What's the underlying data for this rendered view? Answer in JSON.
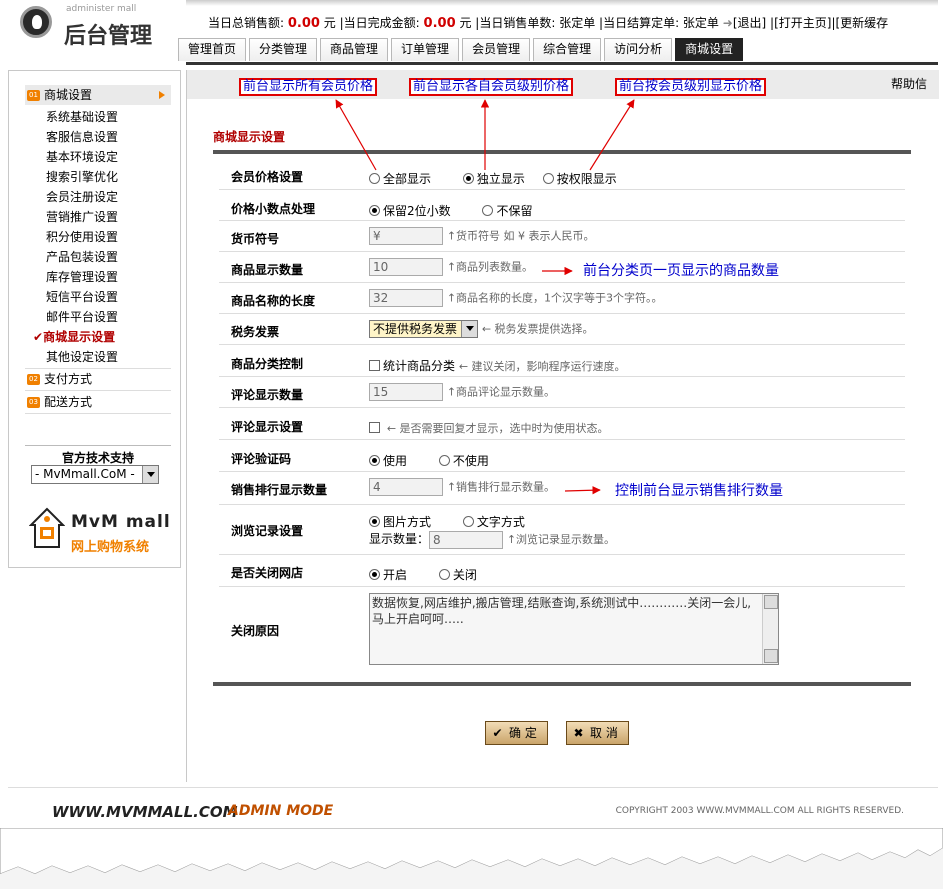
{
  "header": {
    "logo_small": "administer mall",
    "logo_title": "后台管理",
    "stats": {
      "total_sales_label": "当日总销售额:",
      "total_sales_value": "0.00",
      "total_sales_unit": "元",
      "completed_label": "|当日完成金额:",
      "completed_value": "0.00",
      "completed_unit": "元",
      "orders_label": "|当日销售单数: 张定单",
      "settled_label": "|当日结算定单: 张定单",
      "logout": "[退出]",
      "open_home": "|[打开主页]|",
      "update_cache": "[更新缓存"
    },
    "tabs": [
      {
        "label": "管理首页"
      },
      {
        "label": "分类管理"
      },
      {
        "label": "商品管理"
      },
      {
        "label": "订单管理"
      },
      {
        "label": "会员管理"
      },
      {
        "label": "综合管理"
      },
      {
        "label": "访问分析"
      },
      {
        "label": "商城设置"
      }
    ]
  },
  "sidebar": {
    "sections": [
      {
        "num": "01",
        "label": "商城设置"
      },
      {
        "num": "02",
        "label": "支付方式"
      },
      {
        "num": "03",
        "label": "配送方式"
      }
    ],
    "items": [
      "系统基础设置",
      "客服信息设置",
      "基本环境设定",
      "搜索引擎优化",
      "会员注册设定",
      "营销推广设置",
      "积分使用设置",
      "产品包装设置",
      "库存管理设置",
      "短信平台设置",
      "邮件平台设置",
      "商城显示设置",
      "其他设定设置"
    ],
    "current_mark": "✔",
    "support_title": "官方技术支持",
    "support_select": "- MvMmall.CoM -",
    "brand_name": "MvM mall",
    "brand_sub": "网上购物系统"
  },
  "main": {
    "hints": [
      "前台显示所有会员价格",
      "前台显示各自会员级别价格",
      "前台按会员级别显示价格"
    ],
    "help": "帮助信",
    "section_title": "商城显示设置",
    "rows": {
      "member_price": {
        "label": "会员价格设置",
        "opt1": "全部显示",
        "opt2": "独立显示",
        "opt3": "按权限显示",
        "selected": 2
      },
      "decimal": {
        "label": "价格小数点处理",
        "opt1": "保留2位小数",
        "opt2": "不保留",
        "selected": 1
      },
      "currency": {
        "label": "货币符号",
        "value": "¥",
        "note": "↑货币符号 如 ¥ 表示人民币。"
      },
      "goods_count": {
        "label": "商品显示数量",
        "value": "10",
        "note": "↑商品列表数量。"
      },
      "name_length": {
        "label": "商品名称的长度",
        "value": "32",
        "note": "↑商品名称的长度，1个汉字等于3个字符。。"
      },
      "invoice": {
        "label": "税务发票",
        "value": "不提供税务发票",
        "note": "← 税务发票提供选择。"
      },
      "category_ctrl": {
        "label": "商品分类控制",
        "check_label": "统计商品分类",
        "note": "← 建议关闭，影响程序运行速度。"
      },
      "review_count": {
        "label": "评论显示数量",
        "value": "15",
        "note": "↑商品评论显示数量。"
      },
      "review_display": {
        "label": "评论显示设置",
        "note": "← 是否需要回复才显示，选中时为使用状态。"
      },
      "review_captcha": {
        "label": "评论验证码",
        "opt1": "使用",
        "opt2": "不使用",
        "selected": 1
      },
      "sales_rank": {
        "label": "销售排行显示数量",
        "value": "4",
        "note": "↑销售排行显示数量。"
      },
      "browse_history": {
        "label": "浏览记录设置",
        "opt1": "图片方式",
        "opt2": "文字方式",
        "selected": 1,
        "count_label": "显示数量：",
        "count_value": "8",
        "note": "↑浏览记录显示数量。"
      },
      "close_shop": {
        "label": "是否关闭网店",
        "opt1": "开启",
        "opt2": "关闭",
        "selected": 1
      },
      "close_reason": {
        "label": "关闭原因",
        "value": "数据恢复,网店维护,搬店管理,结账查询,系统测试中…………关闭一会儿,马上开启呵呵….."
      }
    },
    "annotations": {
      "goods_count": "前台分类页一页显示的商品数量",
      "sales_rank": "控制前台显示销售排行数量"
    },
    "buttons": {
      "ok": "确 定",
      "cancel": "取 消",
      "ok_icon": "✔",
      "cancel_icon": "✖"
    }
  },
  "footer": {
    "left1": "WWW.MVMMALL.COM",
    "left2": "ADMIN MODE",
    "right": "COPYRIGHT 2003 WWW.MVMMALL.COM ALL RIGHTS RESERVED."
  },
  "colors": {
    "accent_red": "#d00000",
    "annotation_blue": "#0000cc",
    "section_orange": "#f08000",
    "title_red": "#b00000"
  }
}
